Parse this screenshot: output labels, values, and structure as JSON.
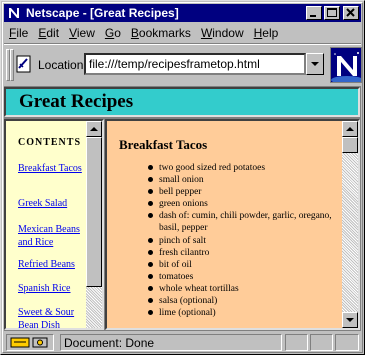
{
  "window": {
    "title": "Netscape - [Great Recipes]"
  },
  "menu": [
    {
      "label": "File",
      "key": "F",
      "rest": "ile"
    },
    {
      "label": "Edit",
      "key": "E",
      "rest": "dit"
    },
    {
      "label": "View",
      "key": "V",
      "rest": "iew"
    },
    {
      "label": "Go",
      "key": "G",
      "rest": "o"
    },
    {
      "label": "Bookmarks",
      "key": "B",
      "rest": "ookmarks"
    },
    {
      "label": "Window",
      "key": "W",
      "rest": "indow"
    },
    {
      "label": "Help",
      "key": "H",
      "rest": "elp"
    }
  ],
  "location": {
    "label": "Location:",
    "url": "file:///temp/recipesframetop.html"
  },
  "banner": {
    "title": "Great Recipes",
    "background": "#33cccc"
  },
  "sidebar": {
    "heading": "CONTENTS",
    "background": "#ffffcc",
    "links": [
      "Breakfast Tacos",
      "Greek Salad",
      "Mexican Beans and Rice",
      "Refried Beans",
      "Spanish Rice",
      "Sweet & Sour Bean Dish"
    ]
  },
  "recipe": {
    "title": "Breakfast Tacos",
    "background": "#ffcc99",
    "ingredients": [
      "two good sized red potatoes",
      "small onion",
      "bell pepper",
      "green onions",
      "dash of: cumin, chili powder, garlic, oregano, basil, pepper",
      "pinch of salt",
      "fresh cilantro",
      "bit of oil",
      "tomatoes",
      "whole wheat tortillas",
      "salsa (optional)",
      "lime (optional)"
    ]
  },
  "status": {
    "text": "Document: Done"
  },
  "icons": {
    "title": "netscape-app-icon",
    "bookmark": "bookmark-icon",
    "logo": "netscape-n-logo",
    "security": "security-key-icon"
  }
}
